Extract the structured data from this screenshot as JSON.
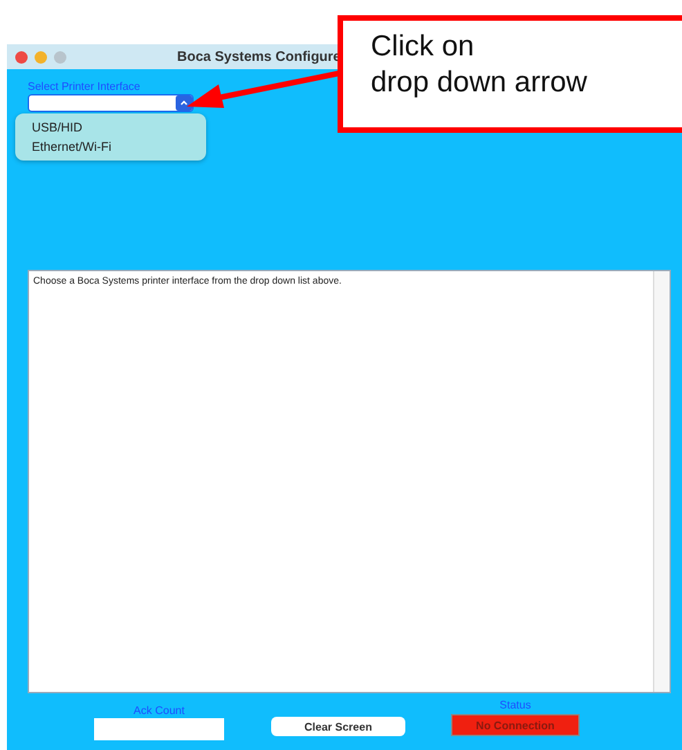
{
  "window": {
    "title": "Boca Systems Configure"
  },
  "callout": {
    "lines": [
      "Click on",
      "drop down arrow"
    ]
  },
  "interface_select": {
    "label": "Select Printer Interface",
    "expanded": true,
    "options": [
      "USB/HID",
      "Ethernet/Wi-Fi"
    ]
  },
  "output": {
    "text": "Choose a Boca Systems printer interface from the drop down list above."
  },
  "ack_count": {
    "label": "Ack Count"
  },
  "clear_button": "Clear Screen",
  "status": {
    "label": "Status",
    "value": "No Connection"
  }
}
